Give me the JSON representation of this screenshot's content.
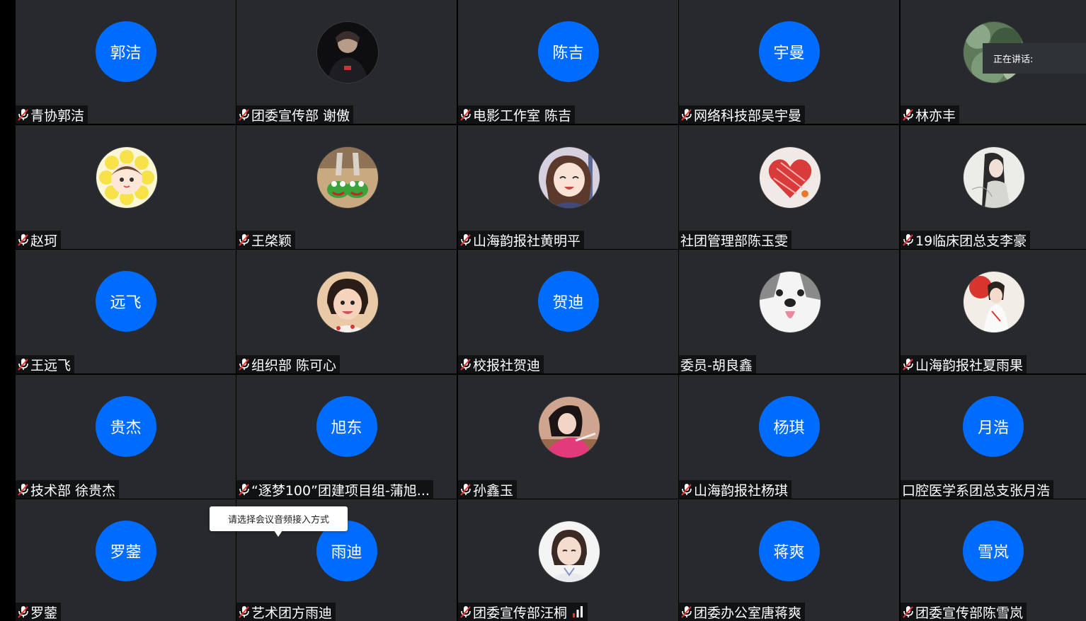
{
  "speaking_panel": {
    "label": "正在讲话:"
  },
  "tooltip": {
    "text": "请选择会议音频接入方式"
  },
  "colors": {
    "tile_bg": "#27292d",
    "avatar_blue": "#006bff",
    "background": "#000000"
  },
  "participants": [
    {
      "name": "青协郭洁",
      "initials": "郭洁",
      "muted": true
    },
    {
      "name": "团委宣传部 谢傲",
      "photo": "dark-portrait",
      "muted": true
    },
    {
      "name": "电影工作室 陈吉",
      "initials": "陈吉",
      "muted": true
    },
    {
      "name": "网络科技部吴宇曼",
      "initials": "宇曼",
      "muted": true
    },
    {
      "name": "林亦丰",
      "photo": "green-foliage",
      "muted": true
    },
    {
      "name": "赵珂",
      "photo": "sunflower-girl",
      "muted": true
    },
    {
      "name": "王棨颖",
      "photo": "frog-slippers",
      "muted": true
    },
    {
      "name": "山海韵报社黄明平",
      "photo": "anime-girl",
      "muted": true
    },
    {
      "name": "社团管理部陈玉雯",
      "photo": "red-heart-drawing",
      "muted": false
    },
    {
      "name": "19临床团总支李豪",
      "photo": "ink-portrait",
      "muted": true
    },
    {
      "name": "王远飞",
      "initials": "远飞",
      "muted": true
    },
    {
      "name": "组织部 陈可心",
      "photo": "little-girl",
      "muted": true
    },
    {
      "name": "校报社贺迪",
      "initials": "贺迪",
      "muted": true
    },
    {
      "name": "委员-胡良鑫",
      "photo": "husky-dog",
      "muted": false
    },
    {
      "name": "山海韵报社夏雨果",
      "photo": "red-illustration",
      "muted": true
    },
    {
      "name": "技术部 徐贵杰",
      "initials": "贵杰",
      "muted": true
    },
    {
      "name": "“逐梦100”团建项目组-蒲旭...",
      "initials": "旭东",
      "muted": true
    },
    {
      "name": "孙鑫玉",
      "photo": "girl-pink",
      "muted": true
    },
    {
      "name": "山海韵报社杨琪",
      "initials": "杨琪",
      "muted": true
    },
    {
      "name": "口腔医学系团总支张月浩",
      "initials": "月浩",
      "muted": false
    },
    {
      "name": "罗蓥",
      "initials": "罗蓥",
      "muted": true
    },
    {
      "name": "艺术团方雨迪",
      "initials": "雨迪",
      "muted": true
    },
    {
      "name": "团委宣传部汪桐",
      "photo": "girl-white",
      "muted": true,
      "signal": true
    },
    {
      "name": "团委办公室唐蒋爽",
      "initials": "蒋爽",
      "muted": true
    },
    {
      "name": "团委宣传部陈雪岚",
      "initials": "雪岚",
      "muted": true
    }
  ]
}
